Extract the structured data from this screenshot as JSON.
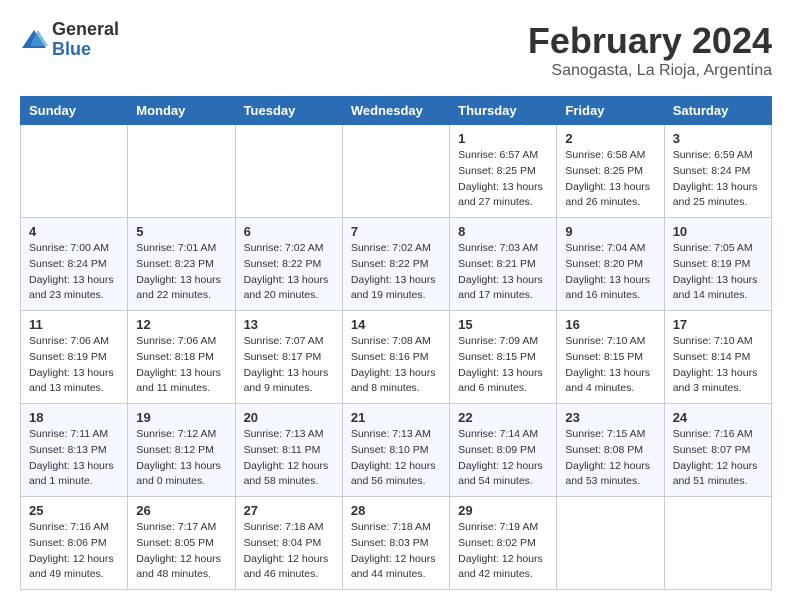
{
  "header": {
    "logo_general": "General",
    "logo_blue": "Blue",
    "main_title": "February 2024",
    "subtitle": "Sanogasta, La Rioja, Argentina"
  },
  "weekdays": [
    "Sunday",
    "Monday",
    "Tuesday",
    "Wednesday",
    "Thursday",
    "Friday",
    "Saturday"
  ],
  "weeks": [
    [
      {
        "day": "",
        "info": ""
      },
      {
        "day": "",
        "info": ""
      },
      {
        "day": "",
        "info": ""
      },
      {
        "day": "",
        "info": ""
      },
      {
        "day": "1",
        "info": "Sunrise: 6:57 AM\nSunset: 8:25 PM\nDaylight: 13 hours\nand 27 minutes."
      },
      {
        "day": "2",
        "info": "Sunrise: 6:58 AM\nSunset: 8:25 PM\nDaylight: 13 hours\nand 26 minutes."
      },
      {
        "day": "3",
        "info": "Sunrise: 6:59 AM\nSunset: 8:24 PM\nDaylight: 13 hours\nand 25 minutes."
      }
    ],
    [
      {
        "day": "4",
        "info": "Sunrise: 7:00 AM\nSunset: 8:24 PM\nDaylight: 13 hours\nand 23 minutes."
      },
      {
        "day": "5",
        "info": "Sunrise: 7:01 AM\nSunset: 8:23 PM\nDaylight: 13 hours\nand 22 minutes."
      },
      {
        "day": "6",
        "info": "Sunrise: 7:02 AM\nSunset: 8:22 PM\nDaylight: 13 hours\nand 20 minutes."
      },
      {
        "day": "7",
        "info": "Sunrise: 7:02 AM\nSunset: 8:22 PM\nDaylight: 13 hours\nand 19 minutes."
      },
      {
        "day": "8",
        "info": "Sunrise: 7:03 AM\nSunset: 8:21 PM\nDaylight: 13 hours\nand 17 minutes."
      },
      {
        "day": "9",
        "info": "Sunrise: 7:04 AM\nSunset: 8:20 PM\nDaylight: 13 hours\nand 16 minutes."
      },
      {
        "day": "10",
        "info": "Sunrise: 7:05 AM\nSunset: 8:19 PM\nDaylight: 13 hours\nand 14 minutes."
      }
    ],
    [
      {
        "day": "11",
        "info": "Sunrise: 7:06 AM\nSunset: 8:19 PM\nDaylight: 13 hours\nand 13 minutes."
      },
      {
        "day": "12",
        "info": "Sunrise: 7:06 AM\nSunset: 8:18 PM\nDaylight: 13 hours\nand 11 minutes."
      },
      {
        "day": "13",
        "info": "Sunrise: 7:07 AM\nSunset: 8:17 PM\nDaylight: 13 hours\nand 9 minutes."
      },
      {
        "day": "14",
        "info": "Sunrise: 7:08 AM\nSunset: 8:16 PM\nDaylight: 13 hours\nand 8 minutes."
      },
      {
        "day": "15",
        "info": "Sunrise: 7:09 AM\nSunset: 8:15 PM\nDaylight: 13 hours\nand 6 minutes."
      },
      {
        "day": "16",
        "info": "Sunrise: 7:10 AM\nSunset: 8:15 PM\nDaylight: 13 hours\nand 4 minutes."
      },
      {
        "day": "17",
        "info": "Sunrise: 7:10 AM\nSunset: 8:14 PM\nDaylight: 13 hours\nand 3 minutes."
      }
    ],
    [
      {
        "day": "18",
        "info": "Sunrise: 7:11 AM\nSunset: 8:13 PM\nDaylight: 13 hours\nand 1 minute."
      },
      {
        "day": "19",
        "info": "Sunrise: 7:12 AM\nSunset: 8:12 PM\nDaylight: 13 hours\nand 0 minutes."
      },
      {
        "day": "20",
        "info": "Sunrise: 7:13 AM\nSunset: 8:11 PM\nDaylight: 12 hours\nand 58 minutes."
      },
      {
        "day": "21",
        "info": "Sunrise: 7:13 AM\nSunset: 8:10 PM\nDaylight: 12 hours\nand 56 minutes."
      },
      {
        "day": "22",
        "info": "Sunrise: 7:14 AM\nSunset: 8:09 PM\nDaylight: 12 hours\nand 54 minutes."
      },
      {
        "day": "23",
        "info": "Sunrise: 7:15 AM\nSunset: 8:08 PM\nDaylight: 12 hours\nand 53 minutes."
      },
      {
        "day": "24",
        "info": "Sunrise: 7:16 AM\nSunset: 8:07 PM\nDaylight: 12 hours\nand 51 minutes."
      }
    ],
    [
      {
        "day": "25",
        "info": "Sunrise: 7:16 AM\nSunset: 8:06 PM\nDaylight: 12 hours\nand 49 minutes."
      },
      {
        "day": "26",
        "info": "Sunrise: 7:17 AM\nSunset: 8:05 PM\nDaylight: 12 hours\nand 48 minutes."
      },
      {
        "day": "27",
        "info": "Sunrise: 7:18 AM\nSunset: 8:04 PM\nDaylight: 12 hours\nand 46 minutes."
      },
      {
        "day": "28",
        "info": "Sunrise: 7:18 AM\nSunset: 8:03 PM\nDaylight: 12 hours\nand 44 minutes."
      },
      {
        "day": "29",
        "info": "Sunrise: 7:19 AM\nSunset: 8:02 PM\nDaylight: 12 hours\nand 42 minutes."
      },
      {
        "day": "",
        "info": ""
      },
      {
        "day": "",
        "info": ""
      }
    ]
  ]
}
